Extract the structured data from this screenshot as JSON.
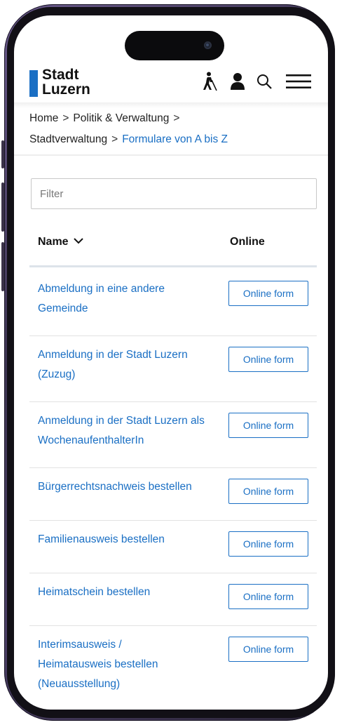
{
  "logo": {
    "line1": "Stadt",
    "line2": "Luzern"
  },
  "header_icons": [
    "accessibility-icon",
    "user-icon",
    "search-icon",
    "menu-icon"
  ],
  "breadcrumb": {
    "items": [
      "Home",
      "Politik & Verwaltung",
      "Stadtverwaltung"
    ],
    "current": "Formulare von A bis Z",
    "separator": ">"
  },
  "filter": {
    "placeholder": "Filter",
    "value": ""
  },
  "table": {
    "col_name": "Name",
    "col_online": "Online",
    "sort_icon": "chevron-down-icon",
    "rows": [
      {
        "name": "Abmeldung in eine andere Gemeinde",
        "button": "Online form"
      },
      {
        "name": "Anmeldung in der Stadt Luzern (Zuzug)",
        "button": "Online form"
      },
      {
        "name": "Anmeldung in der Stadt Luzern als WochenaufenthalterIn",
        "button": "Online form"
      },
      {
        "name": "Bürgerrechtsnachweis bestellen",
        "button": "Online form"
      },
      {
        "name": "Familienausweis bestellen",
        "button": "Online form"
      },
      {
        "name": "Heimatschein bestellen",
        "button": "Online form"
      },
      {
        "name": "Interimsausweis / Heimatausweis bestellen (Neuausstellung)",
        "button": "Online form"
      }
    ]
  },
  "colors": {
    "accent": "#1a6fc4",
    "frame": "#4b3f66"
  }
}
